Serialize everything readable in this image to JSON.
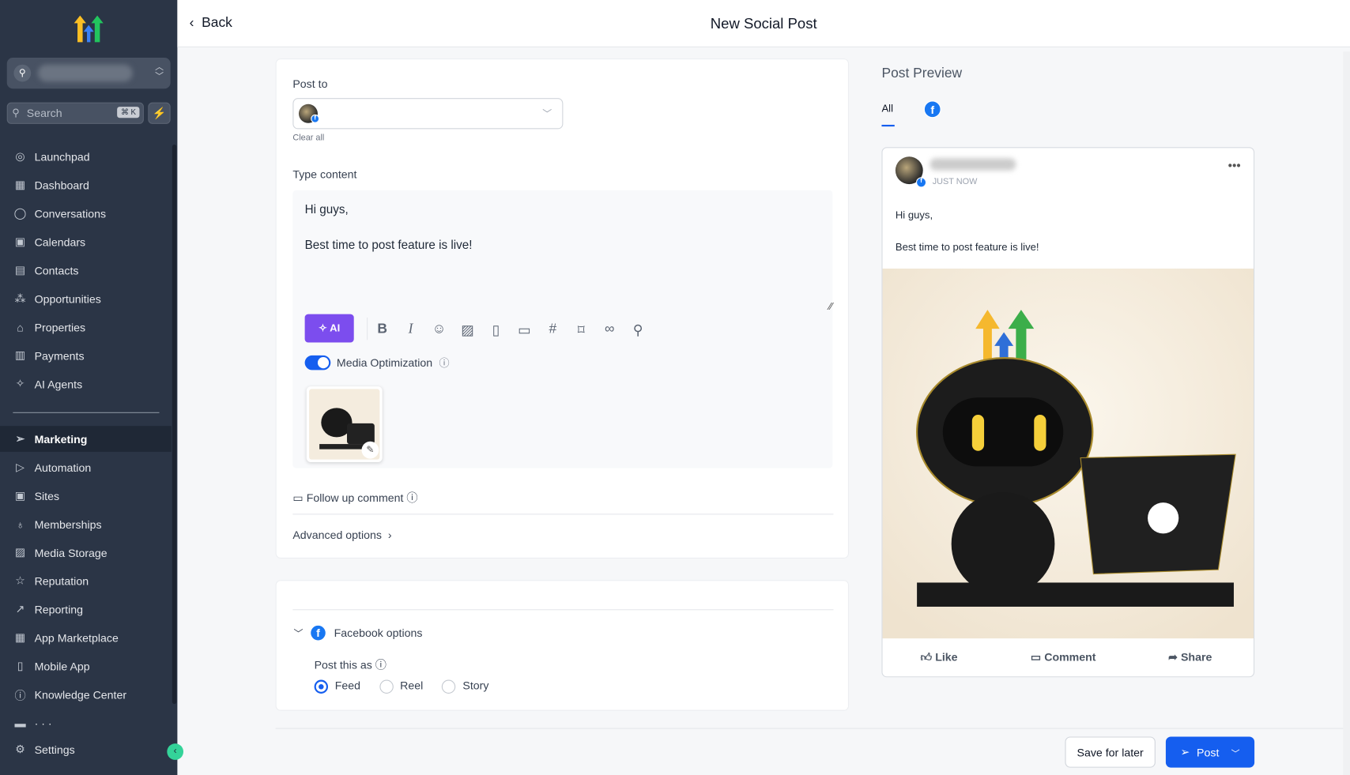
{
  "sidebar": {
    "search_placeholder": "Search",
    "shortcut": "⌘ K",
    "items": [
      {
        "label": "Launchpad",
        "icon": "rocket-icon",
        "g": "◎"
      },
      {
        "label": "Dashboard",
        "icon": "dashboard-icon",
        "g": "▦"
      },
      {
        "label": "Conversations",
        "icon": "chat-icon",
        "g": "◯"
      },
      {
        "label": "Calendars",
        "icon": "calendar-icon",
        "g": "▣"
      },
      {
        "label": "Contacts",
        "icon": "contacts-icon",
        "g": "▤"
      },
      {
        "label": "Opportunities",
        "icon": "opportunities-icon",
        "g": "⁂"
      },
      {
        "label": "Properties",
        "icon": "home-icon",
        "g": "⌂"
      },
      {
        "label": "Payments",
        "icon": "receipt-icon",
        "g": "▥"
      },
      {
        "label": "AI Agents",
        "icon": "sparkle-icon",
        "g": "✧"
      }
    ],
    "items2": [
      {
        "label": "Marketing",
        "icon": "send-icon",
        "g": "➢",
        "active": true
      },
      {
        "label": "Automation",
        "icon": "automation-icon",
        "g": "▷"
      },
      {
        "label": "Sites",
        "icon": "sites-icon",
        "g": "▣"
      },
      {
        "label": "Memberships",
        "icon": "membership-icon",
        "g": "♁"
      },
      {
        "label": "Media Storage",
        "icon": "image-icon",
        "g": "▨"
      },
      {
        "label": "Reputation",
        "icon": "star-icon",
        "g": "☆"
      },
      {
        "label": "Reporting",
        "icon": "trend-icon",
        "g": "↗"
      },
      {
        "label": "App Marketplace",
        "icon": "apps-icon",
        "g": "▦"
      },
      {
        "label": "Mobile App",
        "icon": "mobile-icon",
        "g": "▯"
      },
      {
        "label": "Knowledge Center",
        "icon": "info-icon",
        "g": "ⓘ"
      },
      {
        "label": "· ·  ·",
        "icon": "minus-icon",
        "g": "▬"
      }
    ],
    "settings": "Settings"
  },
  "header": {
    "back": "Back",
    "title": "New Social Post"
  },
  "form": {
    "post_to": "Post to",
    "clear_all": "Clear all",
    "type_content": "Type content",
    "content_line1": "Hi guys,",
    "content_line2": "Best time to post feature is live!",
    "ai": "AI",
    "media_optimization": "Media Optimization",
    "media_optimization_on": true,
    "follow_up": "Follow up comment",
    "advanced": "Advanced options"
  },
  "facebook": {
    "title": "Facebook options",
    "post_as": "Post this as",
    "options": [
      "Feed",
      "Reel",
      "Story"
    ],
    "selected": "Feed"
  },
  "preview": {
    "title": "Post Preview",
    "tab_all": "All",
    "time": "JUST NOW",
    "line1": "Hi guys,",
    "line2": "Best time to post feature is live!",
    "like": "Like",
    "comment": "Comment",
    "share": "Share"
  },
  "footer": {
    "save": "Save for later",
    "post": "Post"
  },
  "colors": {
    "primary": "#155eef",
    "ai": "#7c4dee",
    "sidebar": "#2b3546",
    "facebook": "#1877f2"
  }
}
